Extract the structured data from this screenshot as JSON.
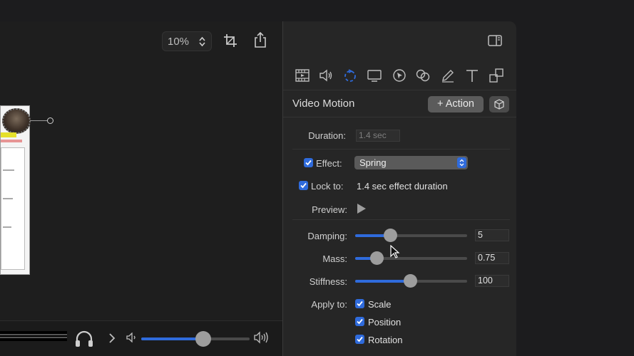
{
  "toolbar": {
    "zoom_value": "10%",
    "crop_icon": "crop-icon",
    "share_icon": "share-icon"
  },
  "inspector": {
    "sidebar_toggle_icon": "sidebar-right-icon",
    "tabs": [
      {
        "name": "video-icon",
        "active": false
      },
      {
        "name": "audio-icon",
        "active": false
      },
      {
        "name": "animation-icon",
        "active": true
      },
      {
        "name": "screen-icon",
        "active": false
      },
      {
        "name": "cursor-icon",
        "active": false
      },
      {
        "name": "filters-icon",
        "active": false
      },
      {
        "name": "annotation-icon",
        "active": false
      },
      {
        "name": "text-icon",
        "active": false
      },
      {
        "name": "transform-icon",
        "active": false
      }
    ],
    "title": "Video Motion",
    "action_button": "+ Action",
    "duration_label": "Duration:",
    "duration_value": "1.4 sec",
    "effect_label": "Effect:",
    "effect_checked": true,
    "effect_value": "Spring",
    "lock_label": "Lock to:",
    "lock_checked": true,
    "lock_value": "1.4 sec effect duration",
    "preview_label": "Preview:",
    "damping_label": "Damping:",
    "damping_value": "5",
    "damping_level": 0.31,
    "mass_label": "Mass:",
    "mass_value": "0.75",
    "mass_level": 0.19,
    "stiffness_label": "Stiffness:",
    "stiffness_value": "100",
    "stiffness_level": 0.49,
    "apply_label": "Apply to:",
    "apply_options": [
      {
        "label": "Scale",
        "checked": true
      },
      {
        "label": "Position",
        "checked": true
      },
      {
        "label": "Rotation",
        "checked": true
      }
    ]
  },
  "playback": {
    "volume_level": 0.57
  },
  "colors": {
    "accent": "#2f6bdc",
    "panel": "#262626",
    "background": "#1c1c1e"
  }
}
